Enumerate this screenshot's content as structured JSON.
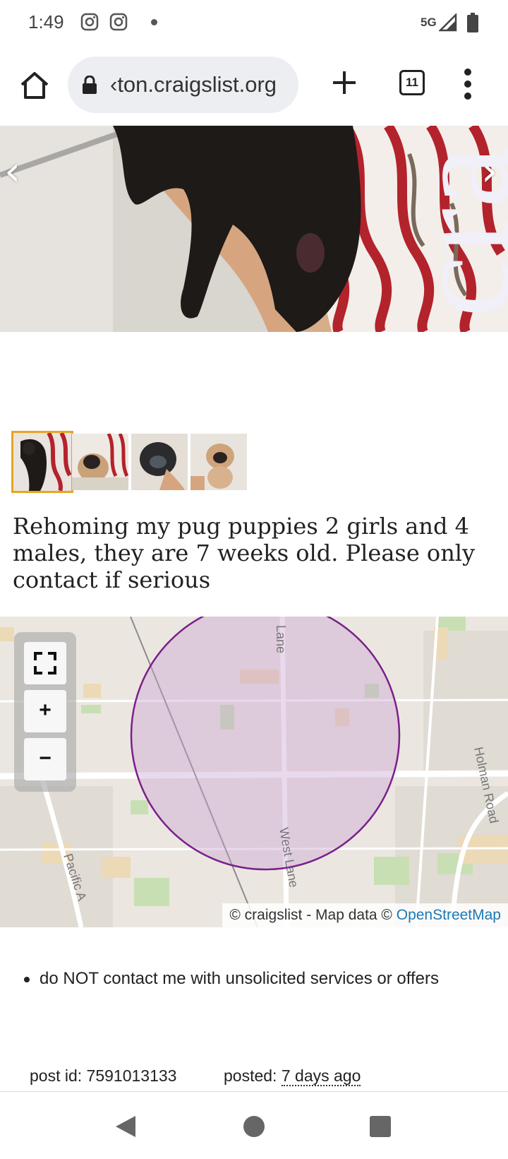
{
  "status_bar": {
    "time": "1:49",
    "network": "5G",
    "notification_icons": [
      "instagram-icon",
      "instagram-icon",
      "dot-icon"
    ]
  },
  "browser": {
    "url": "‹ton.craigslist.org",
    "tab_count": "11"
  },
  "listing": {
    "watermark": "cra",
    "description": "Rehoming my pug puppies 2 girls and 4 males, they are 7 weeks old. Please only contact if serious",
    "thumbnail_count": 4,
    "active_thumbnail": 1
  },
  "map": {
    "fullscreen_icon": "fullscreen-icon",
    "zoom_in": "+",
    "zoom_out": "−",
    "street_labels": [
      "Lane",
      "West Lane",
      "Holman Road",
      "Pacific A"
    ],
    "attribution_prefix": "© craigslist - Map data © ",
    "attribution_link": "OpenStreetMap",
    "circle_color": "#7a1f8c"
  },
  "notice": "do NOT contact me with unsolicited services or offers",
  "post": {
    "id_label": "post id: ",
    "id_value": "7591013133",
    "posted_label": "posted: ",
    "posted_value": "7 days ago"
  },
  "colors": {
    "active_thumb_border": "#e6a521",
    "link": "#1a7ab5"
  }
}
